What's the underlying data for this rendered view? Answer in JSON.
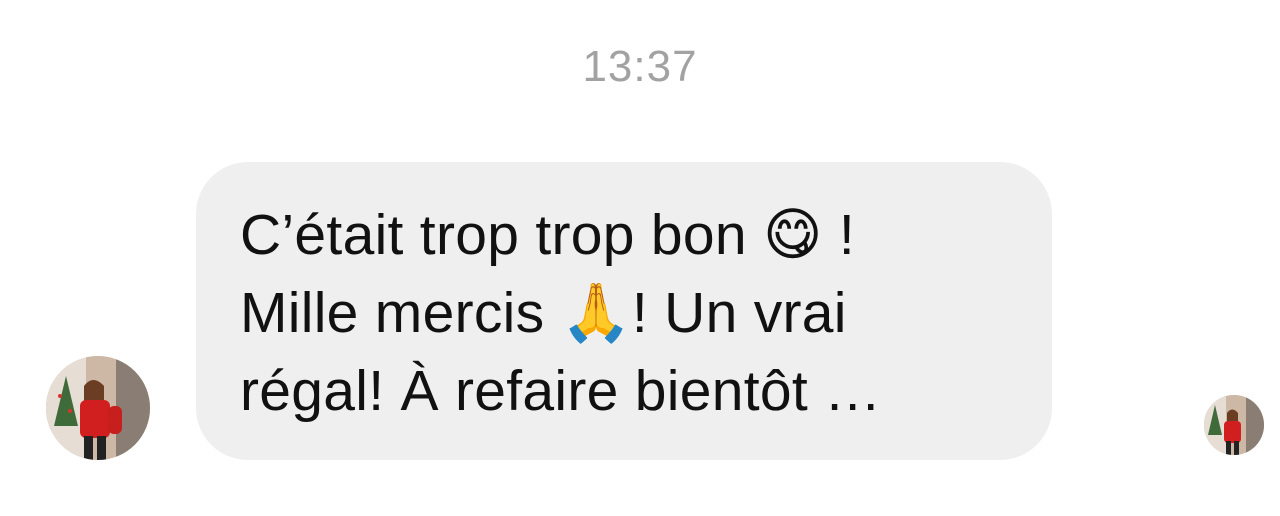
{
  "conversation": {
    "timestamp": "13:37",
    "message": {
      "text": "C’était trop trop bon 😋 !\nMille mercis 🙏! Un vrai\nrégal! À refaire bientôt …"
    }
  }
}
